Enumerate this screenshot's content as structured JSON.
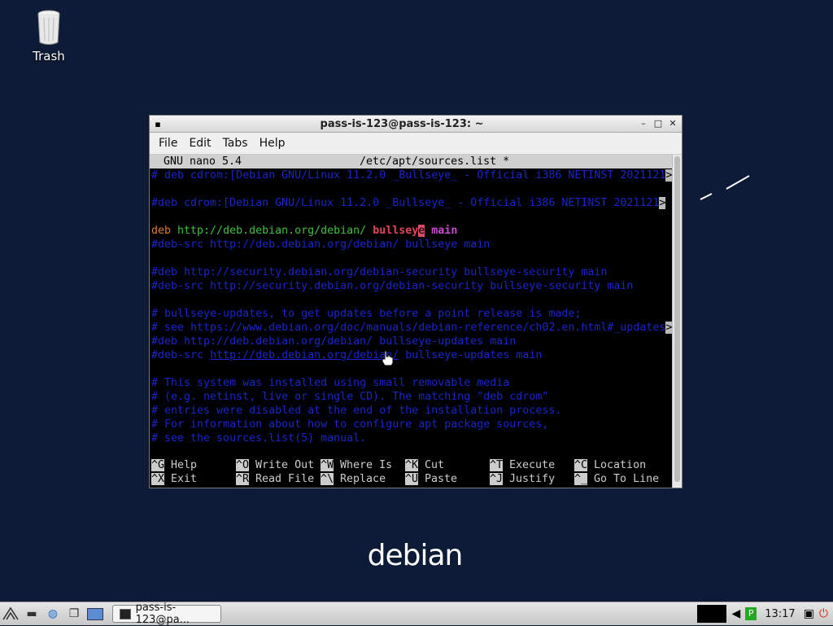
{
  "desktop": {
    "trash_label": "Trash",
    "debian_logo": "debian"
  },
  "window": {
    "title": "pass-is-123@pass-is-123: ~",
    "menu": [
      "File",
      "Edit",
      "Tabs",
      "Help"
    ]
  },
  "nano": {
    "header_left": "GNU nano 5.4",
    "header_file": "/etc/apt/sources.list *",
    "lines": {
      "l1": "# deb cdrom:[Debian GNU/Linux 11.2.0 _Bullseye_ - Official i386 NETINST 2021121",
      "l3": "#deb cdrom:[Debian GNU/Linux 11.2.0 _Bullseye_ - Official i386 NETINST 2021121",
      "l5_deb": "deb ",
      "l5_url": "http://deb.debian.org/debian/",
      "l5_suite": "bullsey",
      "l5_cursor": "e",
      "l5_main": "main",
      "l6": "#deb-src http://deb.debian.org/debian/ bullseye main",
      "l8": "#deb http://security.debian.org/debian-security bullseye-security main",
      "l9": "#deb-src http://security.debian.org/debian-security bullseye-security main",
      "l11": "# bullseye-updates, to get updates before a point release is made;",
      "l12": "# see https://www.debian.org/doc/manuals/debian-reference/ch02.en.html#_updates",
      "l13": "#deb http://deb.debian.org/debian/ bullseye-updates main",
      "l14a": "#deb-src ",
      "l14b": "http://deb.debian.org/debian/",
      "l14c": " bullseye-updates main",
      "l16": "# This system was installed using small removable media",
      "l17": "# (e.g. netinst, live or single CD). The matching \"deb cdrom\"",
      "l18": "# entries were disabled at the end of the installation process.",
      "l19": "# For information about how to configure apt package sources,",
      "l20": "# see the sources.list(5) manual."
    },
    "more_marker": ">",
    "shortcuts": [
      {
        "key": "^G",
        "label": "Help"
      },
      {
        "key": "^O",
        "label": "Write Out"
      },
      {
        "key": "^W",
        "label": "Where Is"
      },
      {
        "key": "^K",
        "label": "Cut"
      },
      {
        "key": "^T",
        "label": "Execute"
      },
      {
        "key": "^C",
        "label": "Location"
      },
      {
        "key": "^X",
        "label": "Exit"
      },
      {
        "key": "^R",
        "label": "Read File"
      },
      {
        "key": "^\\",
        "label": "Replace"
      },
      {
        "key": "^U",
        "label": "Paste"
      },
      {
        "key": "^J",
        "label": "Justify"
      },
      {
        "key": "^_",
        "label": "Go To Line"
      }
    ]
  },
  "taskbar": {
    "task_label": "pass-is-123@pa...",
    "clock": "13:17"
  }
}
